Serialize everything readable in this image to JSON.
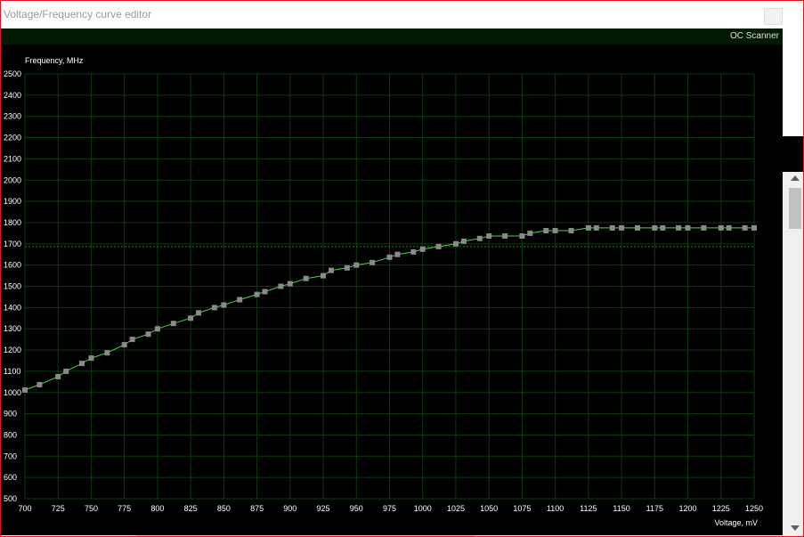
{
  "window": {
    "title": "Voltage/Frequency curve editor"
  },
  "toolbar": {
    "oc_scanner_label": "OC Scanner"
  },
  "colors": {
    "background": "#000000",
    "grid": "#0f3a0f",
    "curve": "#4cd24c",
    "point": "#8a8a8a",
    "reference_line": "#1e8c1e",
    "text": "#ffffff"
  },
  "chart_data": {
    "type": "line",
    "title": "",
    "xlabel": "Voltage, mV",
    "ylabel": "Frequency, MHz",
    "xlim": [
      700,
      1250
    ],
    "ylim": [
      500,
      2500
    ],
    "grid": true,
    "x_ticks": [
      700,
      725,
      750,
      775,
      800,
      825,
      850,
      875,
      900,
      925,
      950,
      975,
      1000,
      1025,
      1050,
      1075,
      1100,
      1125,
      1150,
      1175,
      1200,
      1225,
      1250
    ],
    "y_ticks": [
      500,
      600,
      700,
      800,
      900,
      1000,
      1100,
      1200,
      1300,
      1400,
      1500,
      1600,
      1700,
      1800,
      1900,
      2000,
      2100,
      2200,
      2300,
      2400,
      2500
    ],
    "reference_line_y": 1687,
    "series": [
      {
        "x": [
          700,
          711,
          725,
          731,
          743,
          750,
          762,
          775,
          781,
          793,
          800,
          812,
          825,
          831,
          843,
          850,
          862,
          875,
          881,
          893,
          900,
          912,
          925,
          931,
          943,
          950,
          962,
          975,
          981,
          993,
          1000,
          1012,
          1025,
          1031,
          1043,
          1050,
          1062,
          1075,
          1081,
          1093,
          1100,
          1112,
          1125,
          1131,
          1143,
          1150,
          1162,
          1175,
          1181,
          1193,
          1200,
          1212,
          1225,
          1231,
          1243,
          1250
        ],
        "y": [
          1012,
          1037,
          1075,
          1100,
          1137,
          1162,
          1187,
          1225,
          1250,
          1275,
          1300,
          1325,
          1350,
          1375,
          1400,
          1412,
          1437,
          1462,
          1475,
          1500,
          1512,
          1537,
          1550,
          1575,
          1587,
          1600,
          1612,
          1637,
          1650,
          1662,
          1675,
          1687,
          1700,
          1712,
          1725,
          1737,
          1737,
          1737,
          1750,
          1762,
          1762,
          1762,
          1775,
          1775,
          1775,
          1775,
          1775,
          1775,
          1775,
          1775,
          1775,
          1775,
          1775,
          1775,
          1775,
          1775
        ]
      }
    ]
  }
}
